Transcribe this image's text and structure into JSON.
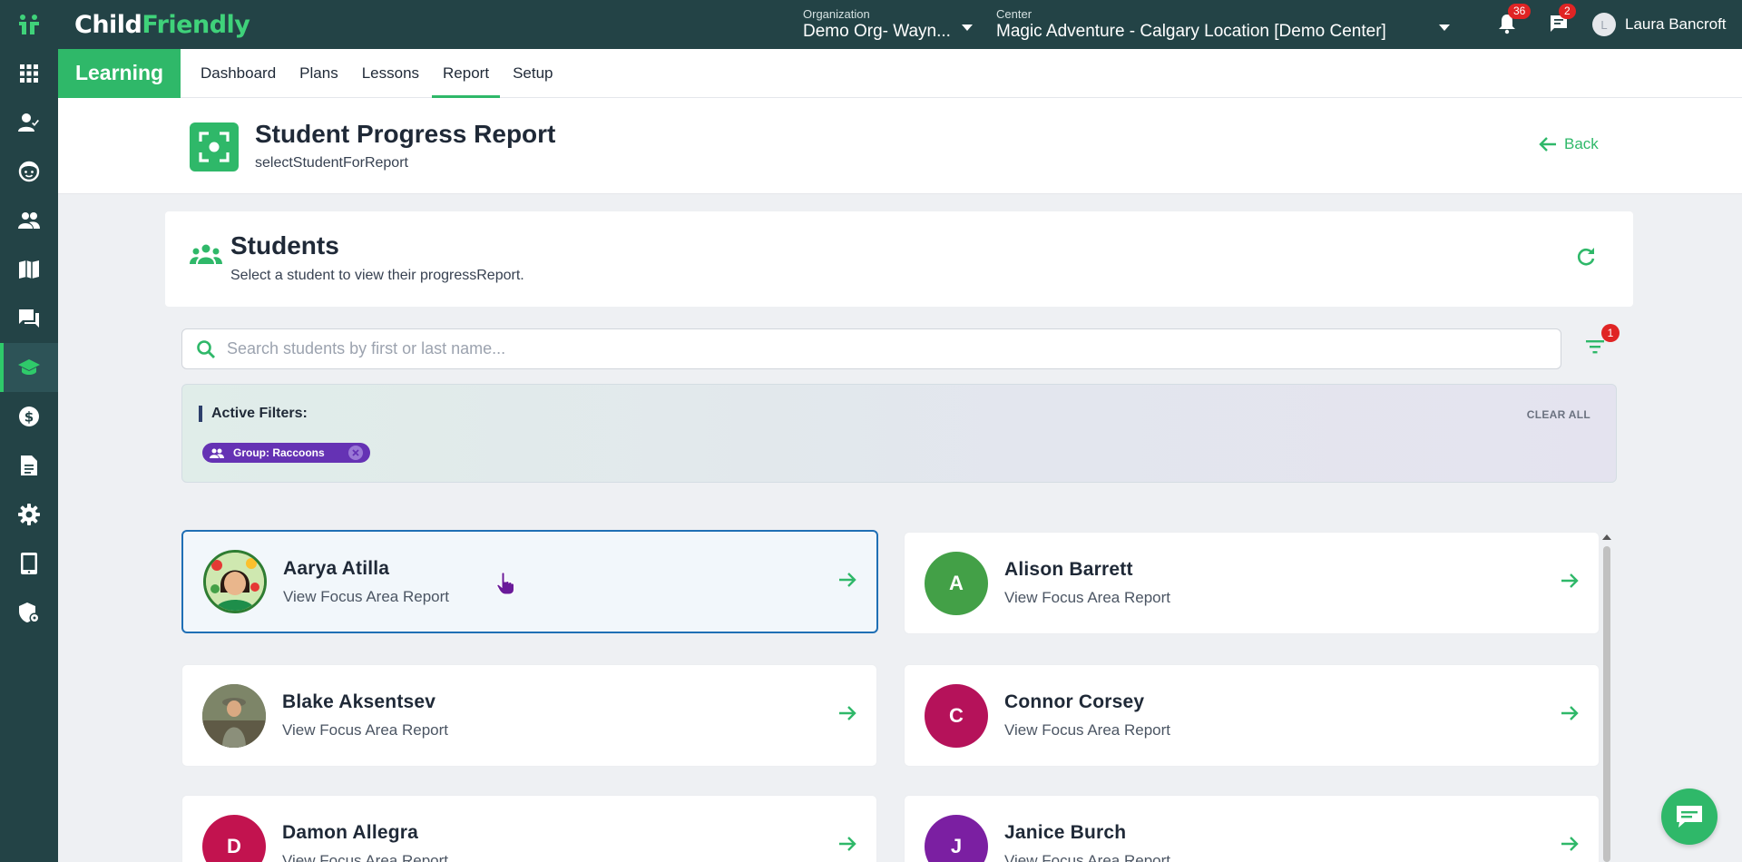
{
  "app": {
    "logo_part1": "Child",
    "logo_part2": "Friendly"
  },
  "topbar": {
    "org_label": "Organization",
    "org_value": "Demo Org- Wayn...",
    "center_label": "Center",
    "center_value": "Magic Adventure - Calgary Location [Demo Center]",
    "notifications_count": "36",
    "messages_count": "2",
    "user_initial": "L",
    "user_name": "Laura Bancroft"
  },
  "sidebar": {
    "items": [
      {
        "icon": "apps-grid-icon"
      },
      {
        "icon": "person-check-icon"
      },
      {
        "icon": "child-face-icon"
      },
      {
        "icon": "people-icon"
      },
      {
        "icon": "map-book-icon"
      },
      {
        "icon": "forum-chat-icon"
      },
      {
        "icon": "school-cap-icon",
        "active": true
      },
      {
        "icon": "dollar-icon"
      },
      {
        "icon": "document-icon"
      },
      {
        "icon": "settings-gear-icon"
      },
      {
        "icon": "tablet-icon"
      },
      {
        "icon": "admin-shield-icon"
      }
    ]
  },
  "subnav": {
    "module": "Learning",
    "tabs": [
      "Dashboard",
      "Plans",
      "Lessons",
      "Report",
      "Setup"
    ],
    "active_tab": "Report"
  },
  "page": {
    "title": "Student Progress Report",
    "subtitle": "selectStudentForReport",
    "back_label": "Back"
  },
  "students_section": {
    "title": "Students",
    "subtitle": "Select a student to view their progressReport."
  },
  "search": {
    "placeholder": "Search students by first or last name...",
    "value": ""
  },
  "filter_badge_count": "1",
  "filters": {
    "label": "Active Filters:",
    "clear_all": "CLEAR ALL",
    "chips": [
      "Group: Raccoons"
    ]
  },
  "students": [
    {
      "name": "Aarya Atilla",
      "link": "View Focus Area Report",
      "initial": "",
      "color": "#2e7d32",
      "photo": true,
      "selected": true
    },
    {
      "name": "Alison Barrett",
      "link": "View Focus Area Report",
      "initial": "A",
      "color": "#43a047",
      "photo": false
    },
    {
      "name": "Blake Aksentsev",
      "link": "View Focus Area Report",
      "initial": "",
      "color": "#5d6b4e",
      "photo": true
    },
    {
      "name": "Connor Corsey",
      "link": "View Focus Area Report",
      "initial": "C",
      "color": "#b5125a",
      "photo": false
    },
    {
      "name": "Damon Allegra",
      "link": "View Focus Area Report",
      "initial": "D",
      "color": "#c2134f",
      "photo": false
    },
    {
      "name": "Janice Burch",
      "link": "View Focus Area Report",
      "initial": "J",
      "color": "#7b1fa2",
      "photo": false
    }
  ],
  "colors": {
    "brand_dark": "#234346",
    "accent_green": "#2fb869",
    "selected_border": "#1f6fb5",
    "chip_purple": "#6532b4",
    "badge_red": "#e02424"
  }
}
